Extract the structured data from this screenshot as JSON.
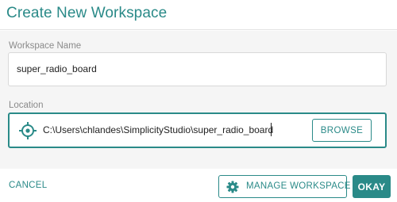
{
  "dialog": {
    "title": "Create New Workspace"
  },
  "workspace_name": {
    "label": "Workspace Name",
    "value": "super_radio_board"
  },
  "location": {
    "label": "Location",
    "value": "C:\\Users\\chlandes\\SimplicityStudio\\super_radio_board",
    "icon": "crosshair-target-icon",
    "browse_label": "BROWSE"
  },
  "footer": {
    "cancel_label": "CANCEL",
    "manage_label": "MANAGE WORKSPACE",
    "manage_icon": "gear-icon",
    "okay_label": "OKAY"
  },
  "colors": {
    "accent": "#2a8a88",
    "background": "#f5f5f5"
  }
}
